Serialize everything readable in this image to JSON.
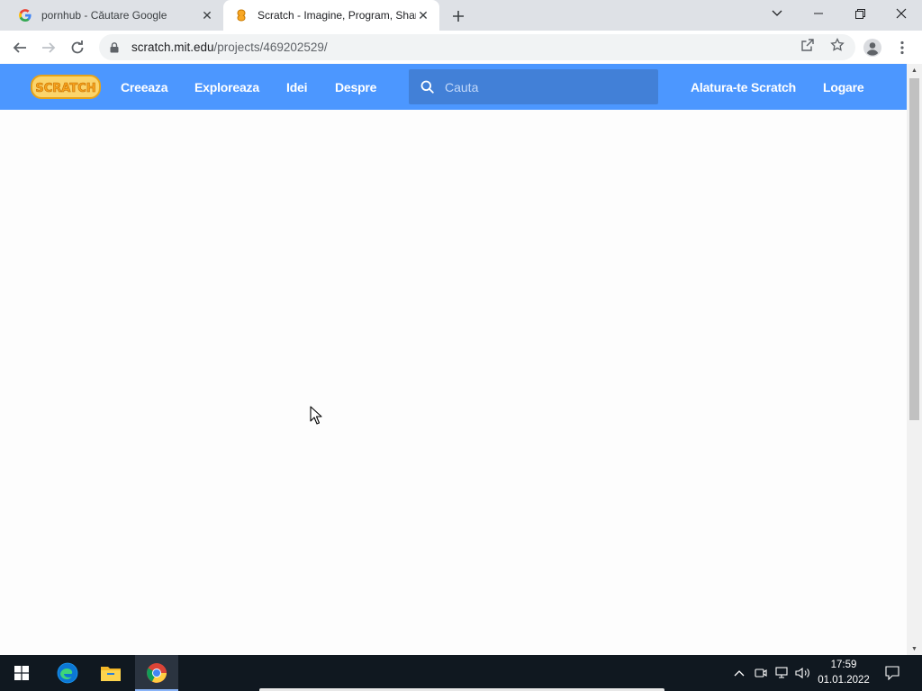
{
  "browser": {
    "tabs": [
      {
        "title": "pornhub - Căutare Google",
        "favicon": "google-g-icon",
        "active": false
      },
      {
        "title": "Scratch - Imagine, Program, Share",
        "favicon": "scratch-cat-icon",
        "active": true
      }
    ],
    "new_tab_icon": "plus-icon",
    "url_host": "scratch.mit.edu",
    "url_path": "/projects/469202529/"
  },
  "scratch": {
    "logo_text": "SCRATCH",
    "nav": {
      "create": "Creeaza",
      "explore": "Exploreaza",
      "ideas": "Idei",
      "about": "Despre"
    },
    "search_placeholder": "Cauta",
    "join": "Alatura-te Scratch",
    "signin": "Logare"
  },
  "taskbar": {
    "time": "17:59",
    "date": "01.01.2022"
  },
  "colors": {
    "scratch_blue": "#4c97ff",
    "search_bg": "#4280d7",
    "logo_orange": "#f9a825",
    "taskbar": "#101820"
  }
}
